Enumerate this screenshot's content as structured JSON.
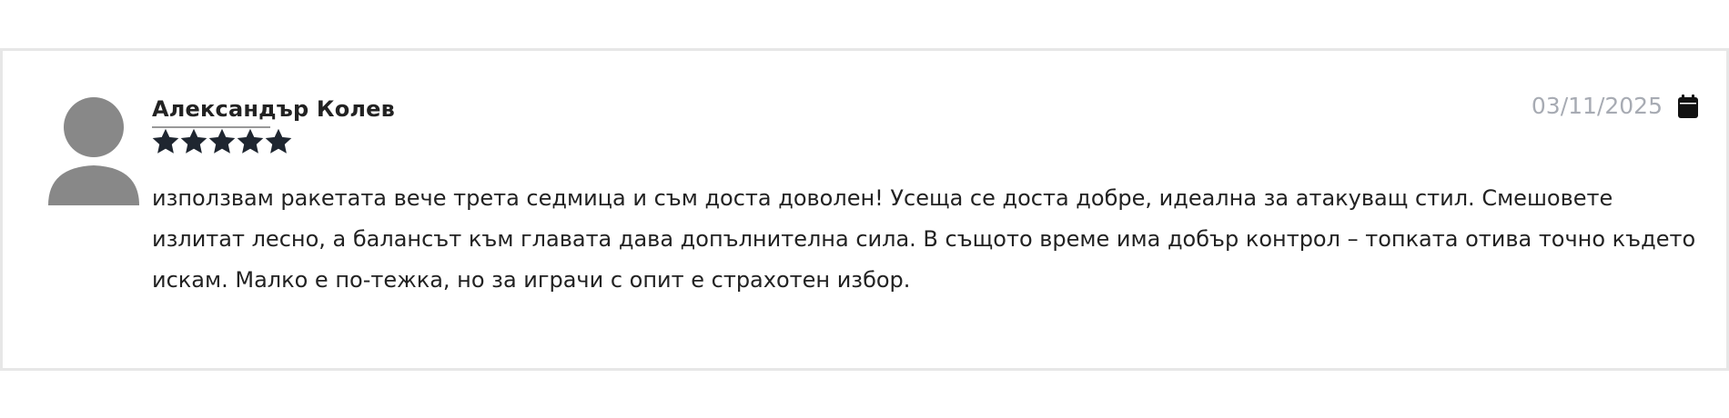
{
  "review": {
    "author": "Александър Колев",
    "rating": 5,
    "rating_max": 5,
    "date": "03/11/2025",
    "text": "използвам ракетата вече трета седмица и съм доста доволен! Усеща се доста добре, идеална за атакуващ стил. Смешовете излитат лесно, а балансът към главата дава допълнителна сила. В същото време има добър контрол – топката отива точно където искам. Малко е по-тежка, но за играчи с опит е страхотен избор.",
    "icons": {
      "avatar": "user-silhouette-icon",
      "star": "star-icon",
      "date": "calendar-icon"
    }
  },
  "colors": {
    "text": "#222222",
    "date": "#a7abb3",
    "avatar": "#888888",
    "border": "#e7e7e7",
    "star": "#1f2630"
  }
}
